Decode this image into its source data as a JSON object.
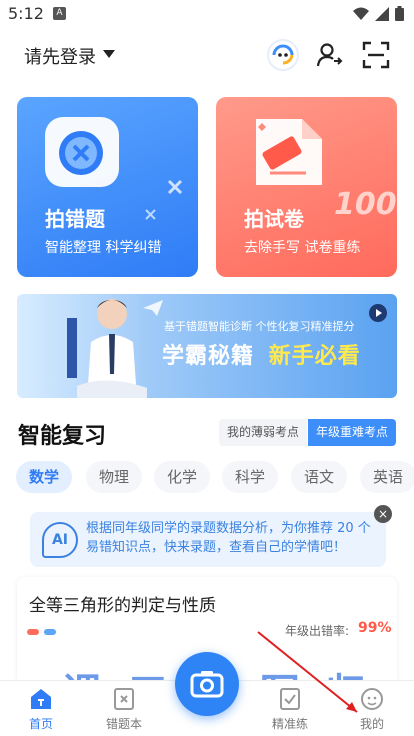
{
  "status_bar": {
    "time": "5:12",
    "notification_letter": "A"
  },
  "header": {
    "login_label": "请先登录"
  },
  "cards": [
    {
      "title": "拍错题",
      "subtitle": "智能整理 科学纠错"
    },
    {
      "title": "拍试卷",
      "subtitle": "去除手写 试卷重练"
    }
  ],
  "banner": {
    "small_text": "基于错题智能诊断 个性化复习精准提分",
    "main_text": "学霸秘籍",
    "accent_text": "新手必看"
  },
  "review": {
    "title": "智能复习",
    "weak_points": "我的薄弱考点",
    "grade_points": "年级重难考点"
  },
  "subject_tabs": [
    "数学",
    "物理",
    "化学",
    "科学",
    "语文",
    "英语"
  ],
  "active_subject": "数学",
  "tip": {
    "badge": "AI",
    "text": "根据同年级同学的录题数据分析，为你推荐 20 个易错知识点，快来录题，查看自己的学情吧！"
  },
  "question_card": {
    "title": "全等三角形的判定与性质",
    "rate_label": "年级出错率:",
    "rate_value": "99%",
    "dot_colors": [
      "#ff6b5b",
      "#5aa5f5"
    ]
  },
  "bottom_nav": {
    "home": "首页",
    "mistakes": "错题本",
    "practice": "精准练",
    "mine": "我的"
  },
  "colors": {
    "primary": "#2f7cf6",
    "danger": "#ff5a4a"
  }
}
